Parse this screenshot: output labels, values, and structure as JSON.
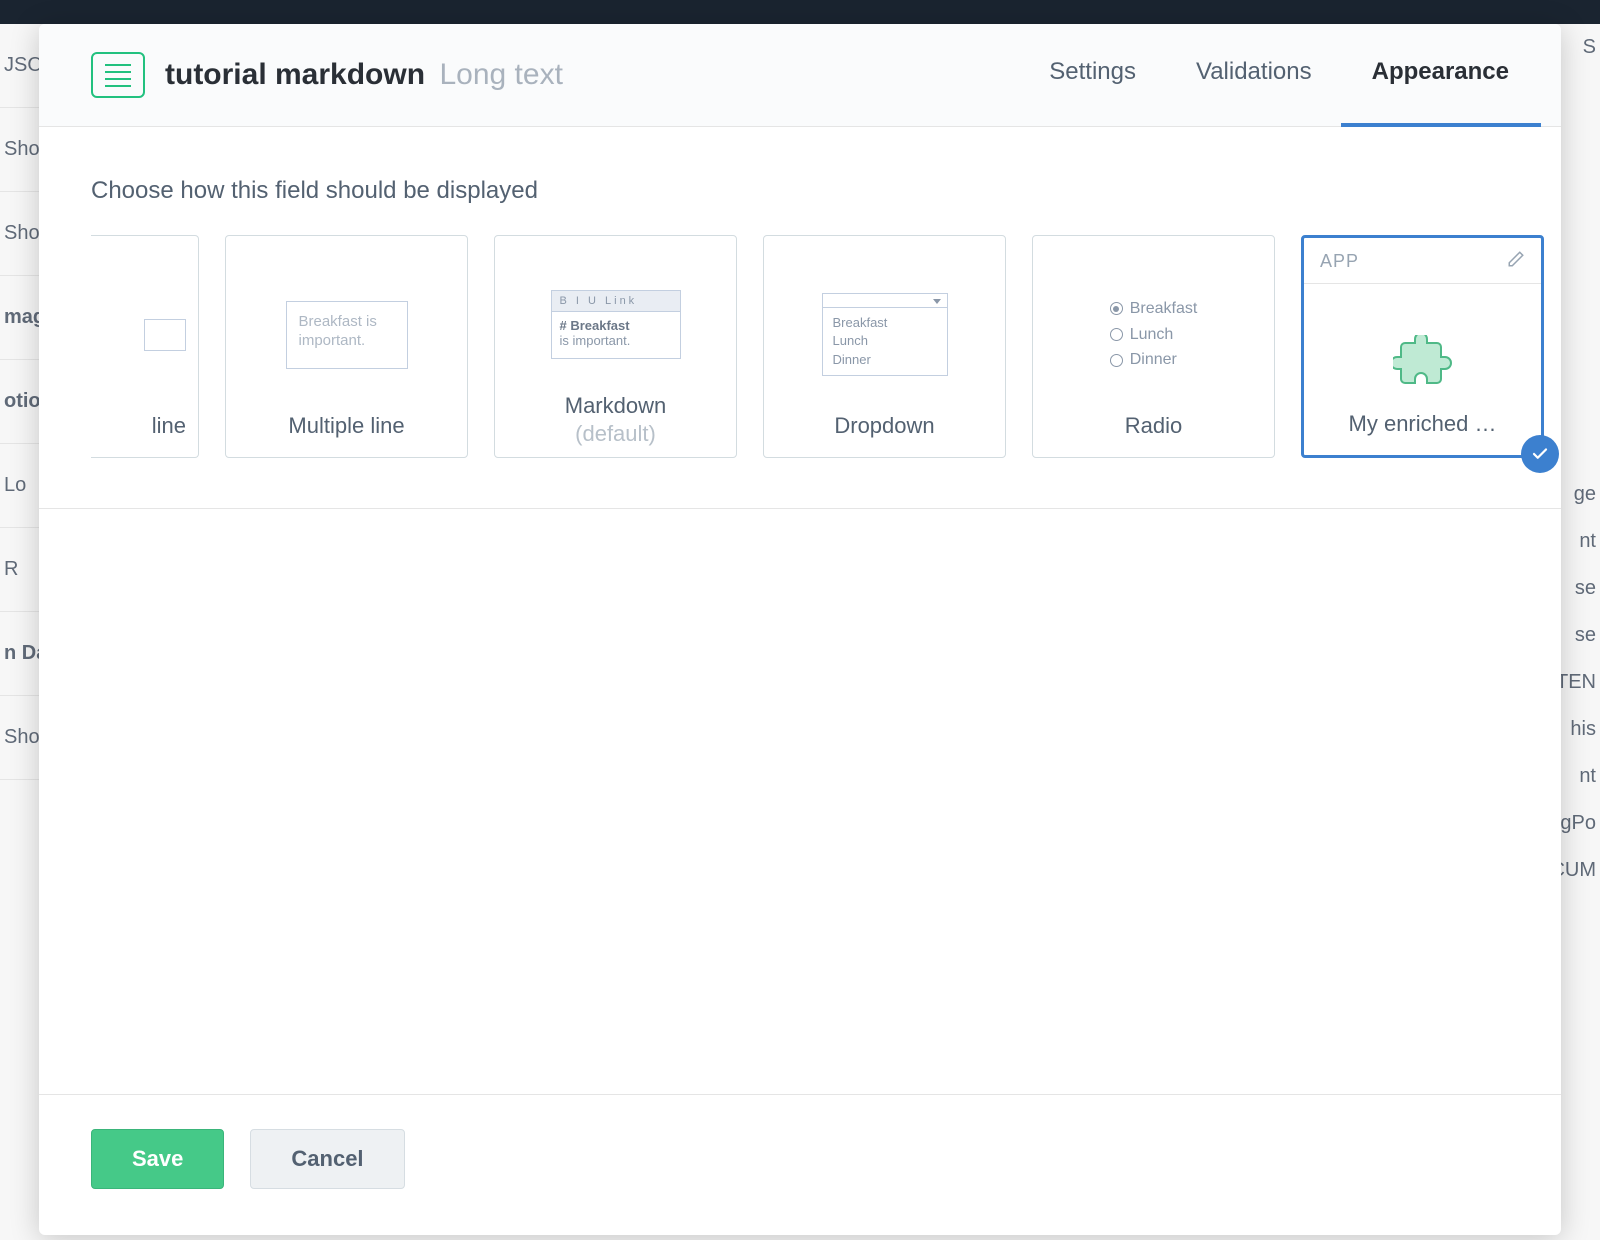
{
  "header": {
    "field_name": "tutorial markdown",
    "field_type": "Long text"
  },
  "tabs": {
    "settings": "Settings",
    "validations": "Validations",
    "appearance": "Appearance"
  },
  "body": {
    "instructions": "Choose how this field should be displayed",
    "options": [
      {
        "label": "line"
      },
      {
        "label": "Multiple line",
        "preview_text": "Breakfast is important."
      },
      {
        "label": "Markdown",
        "sublabel": "(default)",
        "toolbar": "B  I  U  Link",
        "text1": "# Breakfast",
        "text2": "is important."
      },
      {
        "label": "Dropdown",
        "item1": "Breakfast",
        "item2": "Lunch",
        "item3": "Dinner"
      },
      {
        "label": "Radio",
        "item1": "Breakfast",
        "item2": "Lunch",
        "item3": "Dinner"
      },
      {
        "label": "My enriched …",
        "badge": "APP"
      }
    ]
  },
  "footer": {
    "save": "Save",
    "cancel": "Cancel"
  },
  "bg_left": [
    "JSO",
    "Sho",
    "Sho",
    "mag",
    "otio",
    "Lo",
    "R",
    "n Da",
    "Sho"
  ],
  "bg_right": [
    "S",
    "ge",
    "nt",
    "se",
    "se",
    "TEN",
    "his",
    "nt",
    "gPo",
    "DOCUM"
  ]
}
